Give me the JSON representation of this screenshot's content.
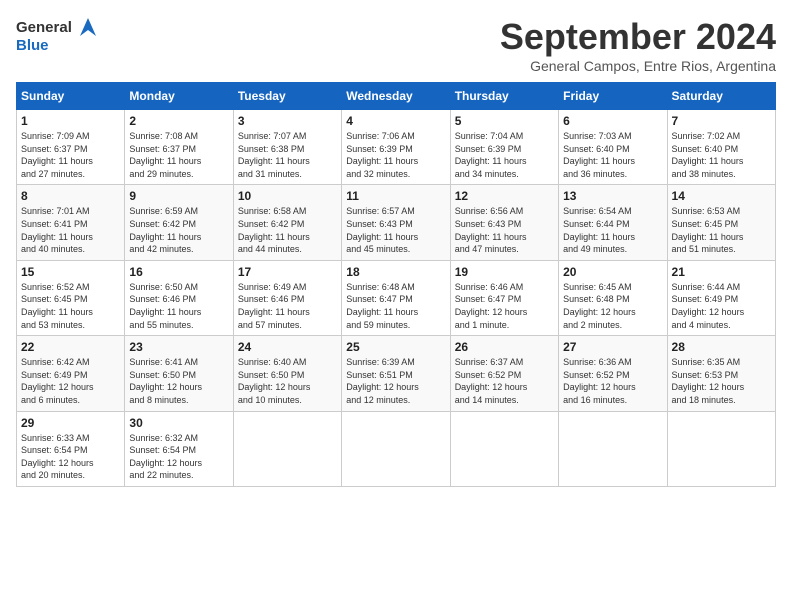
{
  "header": {
    "logo_line1": "General",
    "logo_line2": "Blue",
    "month": "September 2024",
    "location": "General Campos, Entre Rios, Argentina"
  },
  "weekdays": [
    "Sunday",
    "Monday",
    "Tuesday",
    "Wednesday",
    "Thursday",
    "Friday",
    "Saturday"
  ],
  "weeks": [
    [
      {
        "day": "1",
        "sunrise": "7:09 AM",
        "sunset": "6:37 PM",
        "daylight": "11 hours and 27 minutes."
      },
      {
        "day": "2",
        "sunrise": "7:08 AM",
        "sunset": "6:37 PM",
        "daylight": "11 hours and 29 minutes."
      },
      {
        "day": "3",
        "sunrise": "7:07 AM",
        "sunset": "6:38 PM",
        "daylight": "11 hours and 31 minutes."
      },
      {
        "day": "4",
        "sunrise": "7:06 AM",
        "sunset": "6:39 PM",
        "daylight": "11 hours and 32 minutes."
      },
      {
        "day": "5",
        "sunrise": "7:04 AM",
        "sunset": "6:39 PM",
        "daylight": "11 hours and 34 minutes."
      },
      {
        "day": "6",
        "sunrise": "7:03 AM",
        "sunset": "6:40 PM",
        "daylight": "11 hours and 36 minutes."
      },
      {
        "day": "7",
        "sunrise": "7:02 AM",
        "sunset": "6:40 PM",
        "daylight": "11 hours and 38 minutes."
      }
    ],
    [
      {
        "day": "8",
        "sunrise": "7:01 AM",
        "sunset": "6:41 PM",
        "daylight": "11 hours and 40 minutes."
      },
      {
        "day": "9",
        "sunrise": "6:59 AM",
        "sunset": "6:42 PM",
        "daylight": "11 hours and 42 minutes."
      },
      {
        "day": "10",
        "sunrise": "6:58 AM",
        "sunset": "6:42 PM",
        "daylight": "11 hours and 44 minutes."
      },
      {
        "day": "11",
        "sunrise": "6:57 AM",
        "sunset": "6:43 PM",
        "daylight": "11 hours and 45 minutes."
      },
      {
        "day": "12",
        "sunrise": "6:56 AM",
        "sunset": "6:43 PM",
        "daylight": "11 hours and 47 minutes."
      },
      {
        "day": "13",
        "sunrise": "6:54 AM",
        "sunset": "6:44 PM",
        "daylight": "11 hours and 49 minutes."
      },
      {
        "day": "14",
        "sunrise": "6:53 AM",
        "sunset": "6:45 PM",
        "daylight": "11 hours and 51 minutes."
      }
    ],
    [
      {
        "day": "15",
        "sunrise": "6:52 AM",
        "sunset": "6:45 PM",
        "daylight": "11 hours and 53 minutes."
      },
      {
        "day": "16",
        "sunrise": "6:50 AM",
        "sunset": "6:46 PM",
        "daylight": "11 hours and 55 minutes."
      },
      {
        "day": "17",
        "sunrise": "6:49 AM",
        "sunset": "6:46 PM",
        "daylight": "11 hours and 57 minutes."
      },
      {
        "day": "18",
        "sunrise": "6:48 AM",
        "sunset": "6:47 PM",
        "daylight": "11 hours and 59 minutes."
      },
      {
        "day": "19",
        "sunrise": "6:46 AM",
        "sunset": "6:47 PM",
        "daylight": "12 hours and 1 minute."
      },
      {
        "day": "20",
        "sunrise": "6:45 AM",
        "sunset": "6:48 PM",
        "daylight": "12 hours and 2 minutes."
      },
      {
        "day": "21",
        "sunrise": "6:44 AM",
        "sunset": "6:49 PM",
        "daylight": "12 hours and 4 minutes."
      }
    ],
    [
      {
        "day": "22",
        "sunrise": "6:42 AM",
        "sunset": "6:49 PM",
        "daylight": "12 hours and 6 minutes."
      },
      {
        "day": "23",
        "sunrise": "6:41 AM",
        "sunset": "6:50 PM",
        "daylight": "12 hours and 8 minutes."
      },
      {
        "day": "24",
        "sunrise": "6:40 AM",
        "sunset": "6:50 PM",
        "daylight": "12 hours and 10 minutes."
      },
      {
        "day": "25",
        "sunrise": "6:39 AM",
        "sunset": "6:51 PM",
        "daylight": "12 hours and 12 minutes."
      },
      {
        "day": "26",
        "sunrise": "6:37 AM",
        "sunset": "6:52 PM",
        "daylight": "12 hours and 14 minutes."
      },
      {
        "day": "27",
        "sunrise": "6:36 AM",
        "sunset": "6:52 PM",
        "daylight": "12 hours and 16 minutes."
      },
      {
        "day": "28",
        "sunrise": "6:35 AM",
        "sunset": "6:53 PM",
        "daylight": "12 hours and 18 minutes."
      }
    ],
    [
      {
        "day": "29",
        "sunrise": "6:33 AM",
        "sunset": "6:54 PM",
        "daylight": "12 hours and 20 minutes."
      },
      {
        "day": "30",
        "sunrise": "6:32 AM",
        "sunset": "6:54 PM",
        "daylight": "12 hours and 22 minutes."
      },
      null,
      null,
      null,
      null,
      null
    ]
  ],
  "labels": {
    "sunrise": "Sunrise:",
    "sunset": "Sunset:",
    "daylight": "Daylight hours"
  }
}
